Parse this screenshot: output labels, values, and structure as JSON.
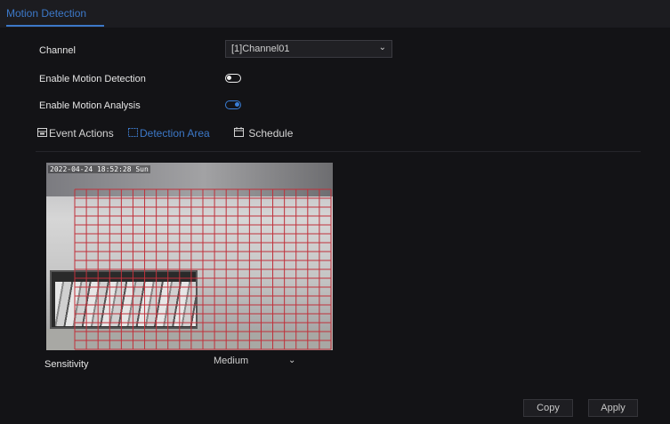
{
  "header": {
    "tab_title": "Motion Detection"
  },
  "form": {
    "channel_label": "Channel",
    "channel_value": "[1]Channel01",
    "enable_motion_label": "Enable Motion Detection",
    "enable_motion_on": false,
    "enable_analysis_label": "Enable Motion Analysis",
    "enable_analysis_on": true
  },
  "subtabs": {
    "event_actions": "Event Actions",
    "detection_area": "Detection Area",
    "schedule": "Schedule",
    "active": "detection_area"
  },
  "preview": {
    "osd_timestamp": "2022-04-24 18:52:28 Sun",
    "grid_color": "#c0303a",
    "grid_cols": 22,
    "grid_rows": 18
  },
  "sensitivity": {
    "label": "Sensitivity",
    "value": "Medium"
  },
  "buttons": {
    "copy": "Copy",
    "apply": "Apply"
  },
  "colors": {
    "accent": "#3c78c8",
    "background": "#131316",
    "toggle_on": "#3a7ed6"
  },
  "icons": {
    "channel_dropdown": "chevron-down-icon",
    "event_actions": "event-actions-icon",
    "detection_area": "detection-area-icon",
    "schedule": "calendar-icon"
  }
}
